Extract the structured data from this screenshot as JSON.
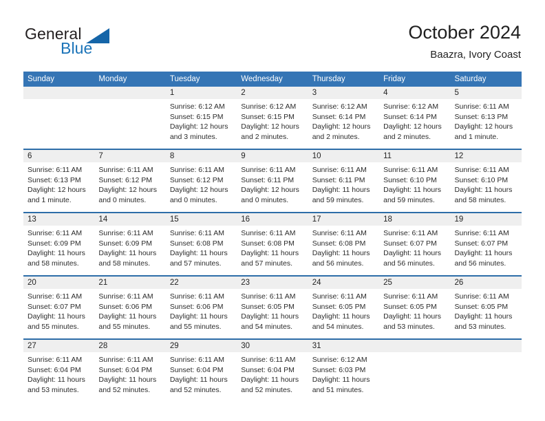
{
  "logo": {
    "word1": "General",
    "word2": "Blue",
    "triangle_color": "#1565a8"
  },
  "header": {
    "title": "October 2024",
    "subtitle": "Baazra, Ivory Coast",
    "accent_color": "#3575b5",
    "row_divider_color": "#2d6da8",
    "daynum_strip_color": "#efefef"
  },
  "weekdays": [
    "Sunday",
    "Monday",
    "Tuesday",
    "Wednesday",
    "Thursday",
    "Friday",
    "Saturday"
  ],
  "weeks": [
    {
      "days": [
        {
          "num": "",
          "lines": []
        },
        {
          "num": "",
          "lines": []
        },
        {
          "num": "1",
          "lines": [
            "Sunrise: 6:12 AM",
            "Sunset: 6:15 PM",
            "Daylight: 12 hours",
            "and 3 minutes."
          ]
        },
        {
          "num": "2",
          "lines": [
            "Sunrise: 6:12 AM",
            "Sunset: 6:15 PM",
            "Daylight: 12 hours",
            "and 2 minutes."
          ]
        },
        {
          "num": "3",
          "lines": [
            "Sunrise: 6:12 AM",
            "Sunset: 6:14 PM",
            "Daylight: 12 hours",
            "and 2 minutes."
          ]
        },
        {
          "num": "4",
          "lines": [
            "Sunrise: 6:12 AM",
            "Sunset: 6:14 PM",
            "Daylight: 12 hours",
            "and 2 minutes."
          ]
        },
        {
          "num": "5",
          "lines": [
            "Sunrise: 6:11 AM",
            "Sunset: 6:13 PM",
            "Daylight: 12 hours",
            "and 1 minute."
          ]
        }
      ]
    },
    {
      "days": [
        {
          "num": "6",
          "lines": [
            "Sunrise: 6:11 AM",
            "Sunset: 6:13 PM",
            "Daylight: 12 hours",
            "and 1 minute."
          ]
        },
        {
          "num": "7",
          "lines": [
            "Sunrise: 6:11 AM",
            "Sunset: 6:12 PM",
            "Daylight: 12 hours",
            "and 0 minutes."
          ]
        },
        {
          "num": "8",
          "lines": [
            "Sunrise: 6:11 AM",
            "Sunset: 6:12 PM",
            "Daylight: 12 hours",
            "and 0 minutes."
          ]
        },
        {
          "num": "9",
          "lines": [
            "Sunrise: 6:11 AM",
            "Sunset: 6:11 PM",
            "Daylight: 12 hours",
            "and 0 minutes."
          ]
        },
        {
          "num": "10",
          "lines": [
            "Sunrise: 6:11 AM",
            "Sunset: 6:11 PM",
            "Daylight: 11 hours",
            "and 59 minutes."
          ]
        },
        {
          "num": "11",
          "lines": [
            "Sunrise: 6:11 AM",
            "Sunset: 6:10 PM",
            "Daylight: 11 hours",
            "and 59 minutes."
          ]
        },
        {
          "num": "12",
          "lines": [
            "Sunrise: 6:11 AM",
            "Sunset: 6:10 PM",
            "Daylight: 11 hours",
            "and 58 minutes."
          ]
        }
      ]
    },
    {
      "days": [
        {
          "num": "13",
          "lines": [
            "Sunrise: 6:11 AM",
            "Sunset: 6:09 PM",
            "Daylight: 11 hours",
            "and 58 minutes."
          ]
        },
        {
          "num": "14",
          "lines": [
            "Sunrise: 6:11 AM",
            "Sunset: 6:09 PM",
            "Daylight: 11 hours",
            "and 58 minutes."
          ]
        },
        {
          "num": "15",
          "lines": [
            "Sunrise: 6:11 AM",
            "Sunset: 6:08 PM",
            "Daylight: 11 hours",
            "and 57 minutes."
          ]
        },
        {
          "num": "16",
          "lines": [
            "Sunrise: 6:11 AM",
            "Sunset: 6:08 PM",
            "Daylight: 11 hours",
            "and 57 minutes."
          ]
        },
        {
          "num": "17",
          "lines": [
            "Sunrise: 6:11 AM",
            "Sunset: 6:08 PM",
            "Daylight: 11 hours",
            "and 56 minutes."
          ]
        },
        {
          "num": "18",
          "lines": [
            "Sunrise: 6:11 AM",
            "Sunset: 6:07 PM",
            "Daylight: 11 hours",
            "and 56 minutes."
          ]
        },
        {
          "num": "19",
          "lines": [
            "Sunrise: 6:11 AM",
            "Sunset: 6:07 PM",
            "Daylight: 11 hours",
            "and 56 minutes."
          ]
        }
      ]
    },
    {
      "days": [
        {
          "num": "20",
          "lines": [
            "Sunrise: 6:11 AM",
            "Sunset: 6:07 PM",
            "Daylight: 11 hours",
            "and 55 minutes."
          ]
        },
        {
          "num": "21",
          "lines": [
            "Sunrise: 6:11 AM",
            "Sunset: 6:06 PM",
            "Daylight: 11 hours",
            "and 55 minutes."
          ]
        },
        {
          "num": "22",
          "lines": [
            "Sunrise: 6:11 AM",
            "Sunset: 6:06 PM",
            "Daylight: 11 hours",
            "and 55 minutes."
          ]
        },
        {
          "num": "23",
          "lines": [
            "Sunrise: 6:11 AM",
            "Sunset: 6:05 PM",
            "Daylight: 11 hours",
            "and 54 minutes."
          ]
        },
        {
          "num": "24",
          "lines": [
            "Sunrise: 6:11 AM",
            "Sunset: 6:05 PM",
            "Daylight: 11 hours",
            "and 54 minutes."
          ]
        },
        {
          "num": "25",
          "lines": [
            "Sunrise: 6:11 AM",
            "Sunset: 6:05 PM",
            "Daylight: 11 hours",
            "and 53 minutes."
          ]
        },
        {
          "num": "26",
          "lines": [
            "Sunrise: 6:11 AM",
            "Sunset: 6:05 PM",
            "Daylight: 11 hours",
            "and 53 minutes."
          ]
        }
      ]
    },
    {
      "days": [
        {
          "num": "27",
          "lines": [
            "Sunrise: 6:11 AM",
            "Sunset: 6:04 PM",
            "Daylight: 11 hours",
            "and 53 minutes."
          ]
        },
        {
          "num": "28",
          "lines": [
            "Sunrise: 6:11 AM",
            "Sunset: 6:04 PM",
            "Daylight: 11 hours",
            "and 52 minutes."
          ]
        },
        {
          "num": "29",
          "lines": [
            "Sunrise: 6:11 AM",
            "Sunset: 6:04 PM",
            "Daylight: 11 hours",
            "and 52 minutes."
          ]
        },
        {
          "num": "30",
          "lines": [
            "Sunrise: 6:11 AM",
            "Sunset: 6:04 PM",
            "Daylight: 11 hours",
            "and 52 minutes."
          ]
        },
        {
          "num": "31",
          "lines": [
            "Sunrise: 6:12 AM",
            "Sunset: 6:03 PM",
            "Daylight: 11 hours",
            "and 51 minutes."
          ]
        },
        {
          "num": "",
          "lines": []
        },
        {
          "num": "",
          "lines": []
        }
      ]
    }
  ]
}
